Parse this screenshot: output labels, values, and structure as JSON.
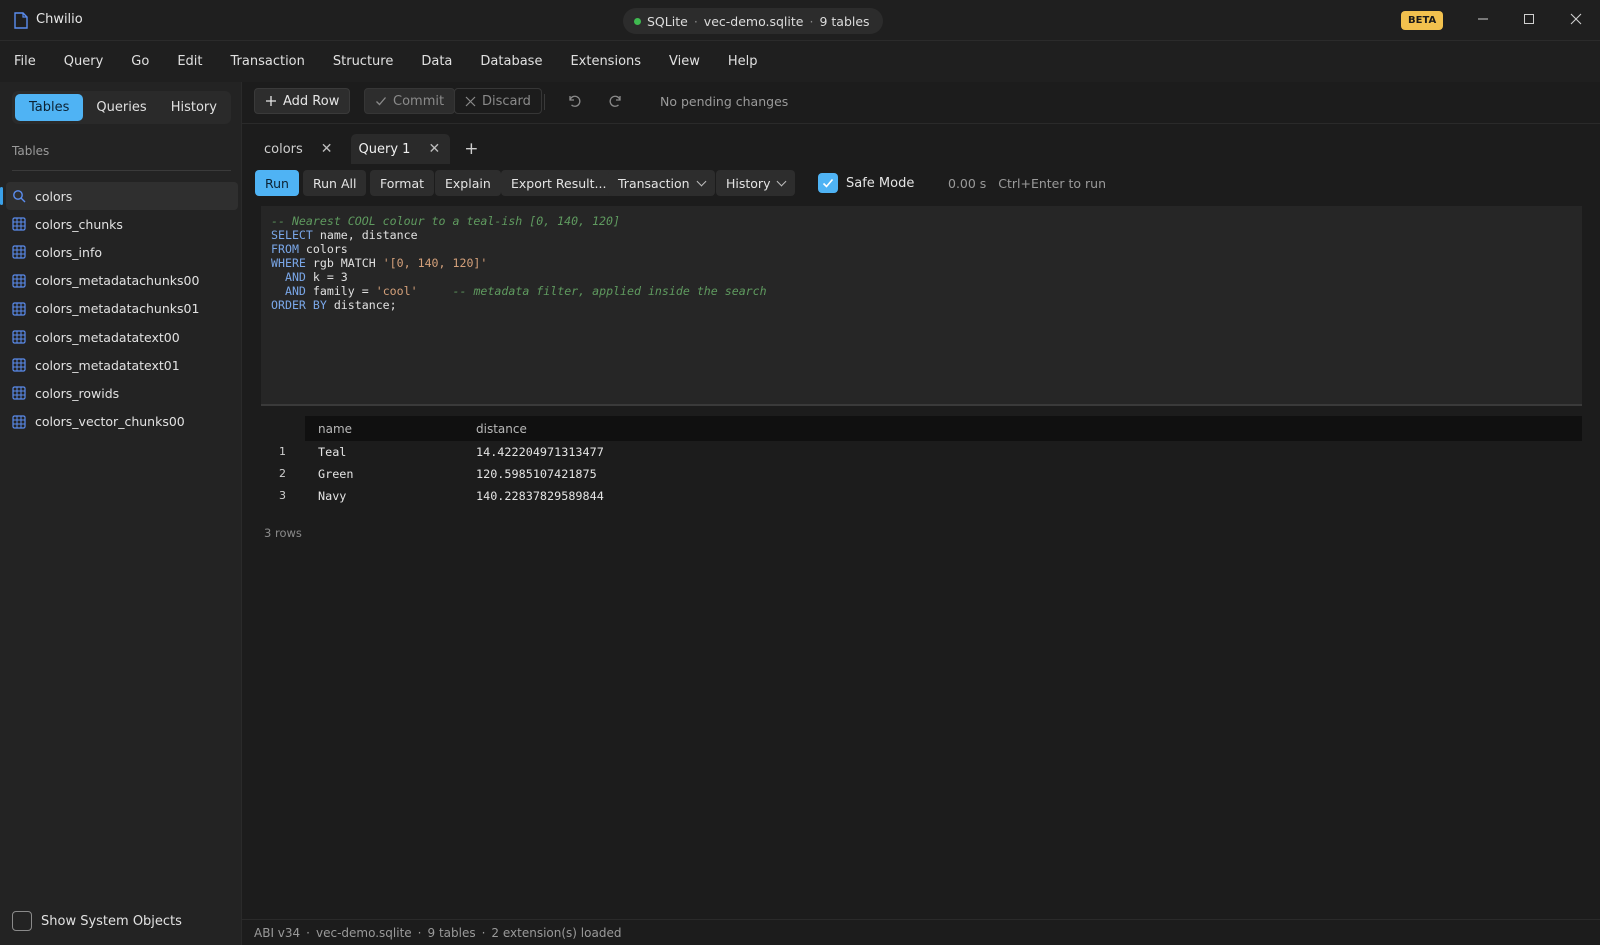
{
  "app": {
    "title": "Chwilio",
    "beta": "BETA"
  },
  "connection": {
    "engine": "SQLite",
    "database": "vec-demo.sqlite",
    "tables": "9 tables",
    "status_color": "#3fb950"
  },
  "colors": {
    "accent": "#4fb3f4",
    "beta_bg": "#f2c14e"
  },
  "menu": [
    "File",
    "Query",
    "Go",
    "Edit",
    "Transaction",
    "Structure",
    "Data",
    "Database",
    "Extensions",
    "View",
    "Help"
  ],
  "sidebar": {
    "segments": [
      "Tables",
      "Queries",
      "History"
    ],
    "active_segment": "Tables",
    "section_label": "Tables",
    "tables": [
      "colors",
      "colors_chunks",
      "colors_info",
      "colors_metadatachunks00",
      "colors_metadatachunks01",
      "colors_metadatatext00",
      "colors_metadatatext01",
      "colors_rowids",
      "colors_vector_chunks00"
    ],
    "selected_table": "colors",
    "show_system_objects": "Show System Objects"
  },
  "toolbar": {
    "add_row": "Add Row",
    "commit": "Commit",
    "discard": "Discard",
    "pending": "No pending changes"
  },
  "tabs": [
    {
      "label": "colors",
      "active": false
    },
    {
      "label": "Query 1",
      "active": true
    }
  ],
  "query_toolbar": {
    "run": "Run",
    "run_all": "Run All",
    "format": "Format",
    "explain": "Explain",
    "export": "Export Result...",
    "transaction": "Transaction",
    "history": "History",
    "safe_mode": "Safe Mode",
    "safe_mode_checked": true,
    "timing": "0.00 s",
    "hint": "Ctrl+Enter to run"
  },
  "editor": {
    "lines": [
      [
        {
          "t": "-- Nearest COOL colour to a teal-ish [0, 140, 120]",
          "c": "cm"
        }
      ],
      [
        {
          "t": "SELECT",
          "c": "kw"
        },
        {
          "t": " name, distance",
          "c": "pl"
        }
      ],
      [
        {
          "t": "FROM",
          "c": "kw"
        },
        {
          "t": " colors",
          "c": "pl"
        }
      ],
      [
        {
          "t": "WHERE",
          "c": "kw"
        },
        {
          "t": " rgb MATCH ",
          "c": "pl"
        },
        {
          "t": "'[0, 140, 120]'",
          "c": "st"
        }
      ],
      [
        {
          "t": "  AND",
          "c": "kw"
        },
        {
          "t": " k = 3",
          "c": "pl"
        }
      ],
      [
        {
          "t": "  AND",
          "c": "kw"
        },
        {
          "t": " family = ",
          "c": "pl"
        },
        {
          "t": "'cool'",
          "c": "st"
        },
        {
          "t": "     ",
          "c": "pl"
        },
        {
          "t": "-- metadata filter, applied inside the search",
          "c": "cm"
        }
      ],
      [
        {
          "t": "ORDER BY",
          "c": "kw"
        },
        {
          "t": " distance;",
          "c": "pl"
        }
      ]
    ]
  },
  "results": {
    "columns": [
      "name",
      "distance"
    ],
    "rows": [
      {
        "n": "1",
        "name": "Teal",
        "distance": "14.422204971313477"
      },
      {
        "n": "2",
        "name": "Green",
        "distance": "120.5985107421875"
      },
      {
        "n": "3",
        "name": "Navy",
        "distance": "140.22837829589844"
      }
    ],
    "row_count": "3 rows"
  },
  "status": {
    "abi": "ABI v34",
    "db": "vec-demo.sqlite",
    "tables": "9 tables",
    "extensions": "2 extension(s) loaded"
  }
}
